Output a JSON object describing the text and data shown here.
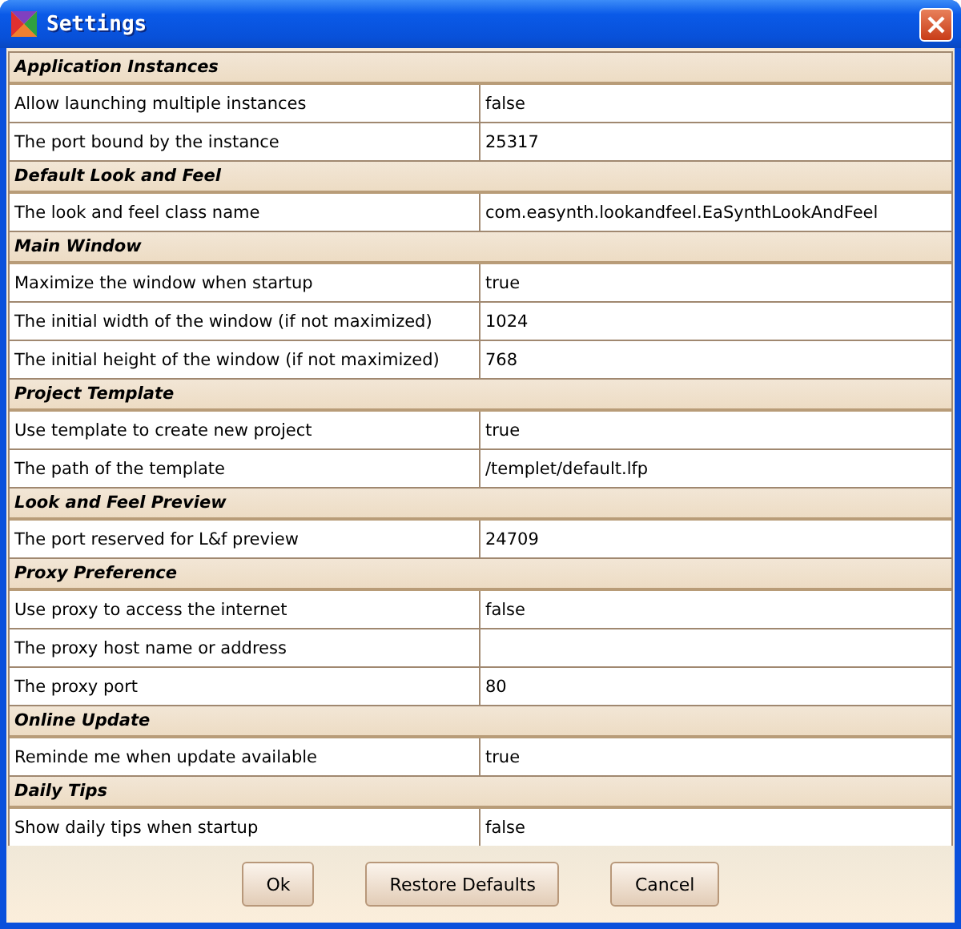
{
  "window": {
    "title": "Settings"
  },
  "sections": [
    {
      "title": "Application Instances",
      "rows": [
        {
          "name": "Allow launching multiple instances",
          "value": "false"
        },
        {
          "name": "The port bound by the instance",
          "value": "25317"
        }
      ]
    },
    {
      "title": "Default Look and Feel",
      "rows": [
        {
          "name": "The look and feel class name",
          "value": "com.easynth.lookandfeel.EaSynthLookAndFeel"
        }
      ]
    },
    {
      "title": "Main Window",
      "rows": [
        {
          "name": "Maximize the window when startup",
          "value": "true"
        },
        {
          "name": "The initial width of the window (if not maximized)",
          "value": "1024"
        },
        {
          "name": "The initial height of the window (if not maximized)",
          "value": "768"
        }
      ]
    },
    {
      "title": "Project Template",
      "rows": [
        {
          "name": "Use template to create new project",
          "value": "true"
        },
        {
          "name": "The path of the template",
          "value": "/templet/default.lfp"
        }
      ]
    },
    {
      "title": "Look and Feel Preview",
      "rows": [
        {
          "name": "The port reserved for L&f preview",
          "value": "24709"
        }
      ]
    },
    {
      "title": "Proxy Preference",
      "rows": [
        {
          "name": "Use proxy to access the internet",
          "value": "false"
        },
        {
          "name": "The proxy host name or address",
          "value": ""
        },
        {
          "name": "The proxy port",
          "value": "80"
        }
      ]
    },
    {
      "title": "Online Update",
      "rows": [
        {
          "name": "Reminde me when update available",
          "value": "true"
        }
      ]
    },
    {
      "title": "Daily Tips",
      "rows": [
        {
          "name": "Show daily tips when startup",
          "value": "false"
        }
      ]
    }
  ],
  "buttons": [
    "Ok",
    "Restore Defaults",
    "Cancel"
  ]
}
